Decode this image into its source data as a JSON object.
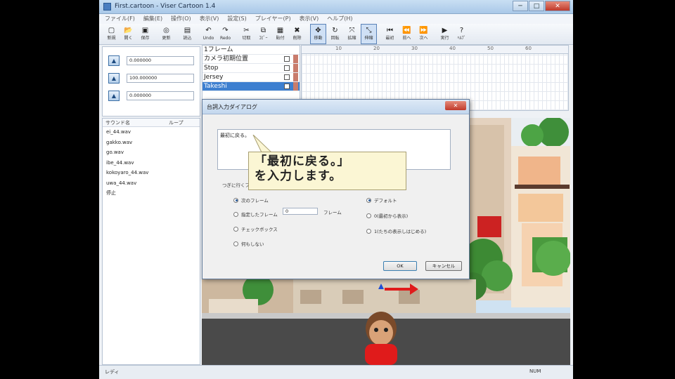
{
  "window": {
    "title": "First.cartoon - Viser Cartoon 1.4",
    "btn_min": "─",
    "btn_max": "□",
    "btn_close": "✕"
  },
  "menu": [
    "ファイル(F)",
    "編集(E)",
    "操作(O)",
    "表示(V)",
    "設定(S)",
    "プレイヤー(P)",
    "表示(V)",
    "ヘルプ(H)"
  ],
  "toolbar": [
    {
      "icon": "new-icon",
      "glyph": "▢",
      "label": "新規"
    },
    {
      "icon": "open-icon",
      "glyph": "📂",
      "label": "開く"
    },
    {
      "icon": "save-icon",
      "glyph": "▣",
      "label": "保存"
    },
    {
      "icon": "refresh-icon",
      "glyph": "◎",
      "label": "更新"
    },
    {
      "icon": "import-icon",
      "glyph": "▤",
      "label": "読込"
    },
    {
      "icon": "undo-icon",
      "glyph": "↶",
      "label": "Undo"
    },
    {
      "icon": "redo-icon",
      "glyph": "↷",
      "label": "Redo"
    },
    {
      "icon": "cut-icon",
      "glyph": "✂",
      "label": "切取"
    },
    {
      "icon": "copy-icon",
      "glyph": "⧉",
      "label": "ｺﾋﾟｰ"
    },
    {
      "icon": "paste-icon",
      "glyph": "▦",
      "label": "貼付"
    },
    {
      "icon": "delete-icon",
      "glyph": "✖",
      "label": "削除"
    },
    {
      "icon": "move-icon",
      "glyph": "✥",
      "label": "移動"
    },
    {
      "icon": "rotate-icon",
      "glyph": "↻",
      "label": "回転"
    },
    {
      "icon": "scale-icon",
      "glyph": "⤧",
      "label": "拡縮"
    },
    {
      "icon": "resize-icon",
      "glyph": "⤡",
      "label": "伸縮"
    },
    {
      "icon": "first-icon",
      "glyph": "⏮",
      "label": "最初"
    },
    {
      "icon": "prev-icon",
      "glyph": "⏪",
      "label": "前へ"
    },
    {
      "icon": "next-icon",
      "glyph": "⏩",
      "label": "次へ"
    },
    {
      "icon": "play-icon",
      "glyph": "▶",
      "label": "実行"
    },
    {
      "icon": "help-icon",
      "glyph": "?",
      "label": "ﾍﾙﾌﾟ"
    }
  ],
  "camera": {
    "values": [
      "0.000000",
      "100.000000",
      "0.000000"
    ]
  },
  "tracks": {
    "header": "1フレーム",
    "items": [
      {
        "name": "カメラ初期位置",
        "selected": false
      },
      {
        "name": "Stop",
        "selected": false
      },
      {
        "name": "Jersey",
        "selected": false
      },
      {
        "name": "Takeshi",
        "selected": true
      }
    ]
  },
  "timeline": {
    "ticks": [
      "10",
      "20",
      "30",
      "40",
      "50",
      "60"
    ]
  },
  "sounds": {
    "col_name": "サウンド名",
    "col_loop": "ループ",
    "items": [
      "ei_44.wav",
      "gakko.wav",
      "go.wav",
      "ibe_44.wav",
      "kokoyaro_44.wav",
      "uwa_44.wav",
      "停止"
    ]
  },
  "dialog": {
    "title": "台詞入力ダイアログ",
    "close": "✕",
    "text": "最初に戻る。",
    "group_label": "つぎに行くフレーム",
    "left_options": [
      "次のフレーム",
      "指定したフレーム",
      "チェックボックス",
      "何もしない"
    ],
    "frame_value": "0",
    "frame_unit": "フレーム",
    "right_options": [
      "デフォルト",
      "0(最初から表示)",
      "1(たちの表示しはじめる)"
    ],
    "ok": "OK",
    "cancel": "キャンセル"
  },
  "callout": {
    "line1": "「最初に戻る。」",
    "line2": "を入力します。"
  },
  "status": {
    "left": "レディ",
    "right": "NUM"
  }
}
